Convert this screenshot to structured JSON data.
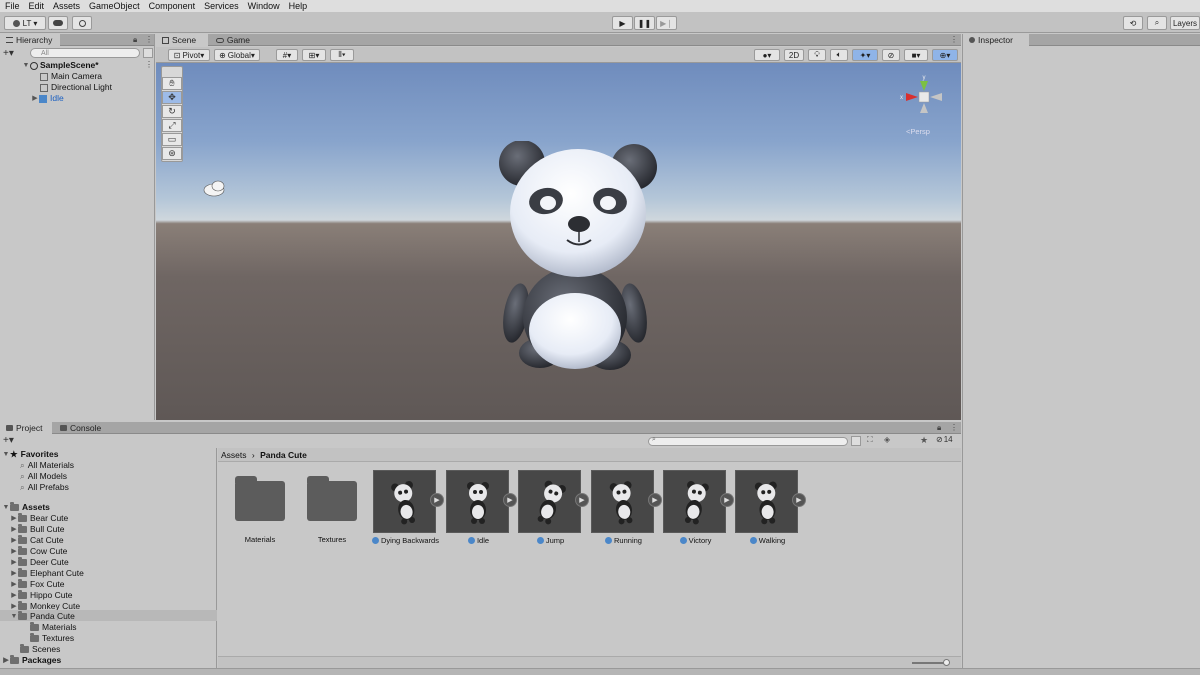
{
  "menubar": [
    "File",
    "Edit",
    "Assets",
    "GameObject",
    "Component",
    "Services",
    "Window",
    "Help"
  ],
  "toolbar": {
    "account_label": "LT",
    "layers_label": "Layers"
  },
  "hierarchy": {
    "tab_label": "Hierarchy",
    "search_placeholder": "All",
    "scene_name": "SampleScene*",
    "items": [
      "Main Camera",
      "Directional Light",
      "Idle"
    ]
  },
  "scene": {
    "tab_scene": "Scene",
    "tab_game": "Game",
    "pivot_label": "Pivot",
    "global_label": "Global",
    "mode_2d": "2D",
    "persp_label": "<Persp"
  },
  "inspector": {
    "tab_label": "Inspector"
  },
  "project": {
    "tab_project": "Project",
    "tab_console": "Console",
    "hidden_count": "14",
    "favorites_label": "Favorites",
    "favorites": [
      "All Materials",
      "All Models",
      "All Prefabs"
    ],
    "assets_label": "Assets",
    "asset_folders": [
      "Bear Cute",
      "Bull Cute",
      "Cat Cute",
      "Cow Cute",
      "Deer Cute",
      "Elephant Cute",
      "Fox Cute",
      "Hippo Cute",
      "Monkey Cute",
      "Panda Cute"
    ],
    "panda_children": [
      "Materials",
      "Textures"
    ],
    "scenes_label": "Scenes",
    "packages_label": "Packages",
    "breadcrumb_root": "Assets",
    "breadcrumb_current": "Panda Cute",
    "grid_folders": [
      "Materials",
      "Textures"
    ],
    "grid_animations": [
      "Dying Backwards",
      "Idle",
      "Jump",
      "Running",
      "Victory",
      "Walking"
    ]
  },
  "colors": {
    "accent": "#3d7bd5",
    "selection": "#b8b8b8"
  }
}
